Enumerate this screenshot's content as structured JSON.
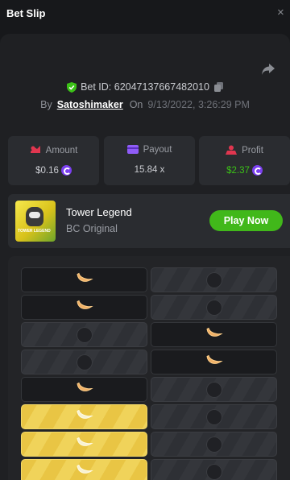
{
  "header": {
    "title": "Bet Slip",
    "close_glyph": "×"
  },
  "bet": {
    "id_label": "Bet ID: 62047137667482010",
    "by_label": "By",
    "user": "Satoshimaker",
    "on_label": "On",
    "datetime": "9/13/2022, 3:26:29 PM"
  },
  "stats": {
    "amount": {
      "label": "Amount",
      "value": "$0.16"
    },
    "payout": {
      "label": "Payout",
      "value": "15.84 x"
    },
    "profit": {
      "label": "Profit",
      "value": "$2.37"
    }
  },
  "game": {
    "name": "Tower Legend",
    "provider": "BC Original",
    "thumb_text": "TOWER LEGEND",
    "play_label": "Play Now"
  },
  "board": {
    "rows": [
      [
        "banana-dark",
        "empty-grey"
      ],
      [
        "banana-dark",
        "empty-grey"
      ],
      [
        "empty-grey",
        "banana-dark"
      ],
      [
        "empty-grey",
        "banana-dark"
      ],
      [
        "banana-dark",
        "empty-grey"
      ],
      [
        "banana-gold",
        "empty-grey"
      ],
      [
        "banana-gold",
        "empty-grey"
      ],
      [
        "banana-gold",
        "empty-grey"
      ]
    ]
  },
  "colors": {
    "accent_green": "#41b81a",
    "profit_green": "#3bc117",
    "coin_purple": "#7b3ff0",
    "gold_tile": "#e9c544"
  },
  "icons": [
    "close-icon",
    "share-icon",
    "shield-check-icon",
    "copy-icon",
    "amount-icon",
    "payout-icon",
    "profit-icon",
    "coin-icon",
    "banana-icon"
  ]
}
